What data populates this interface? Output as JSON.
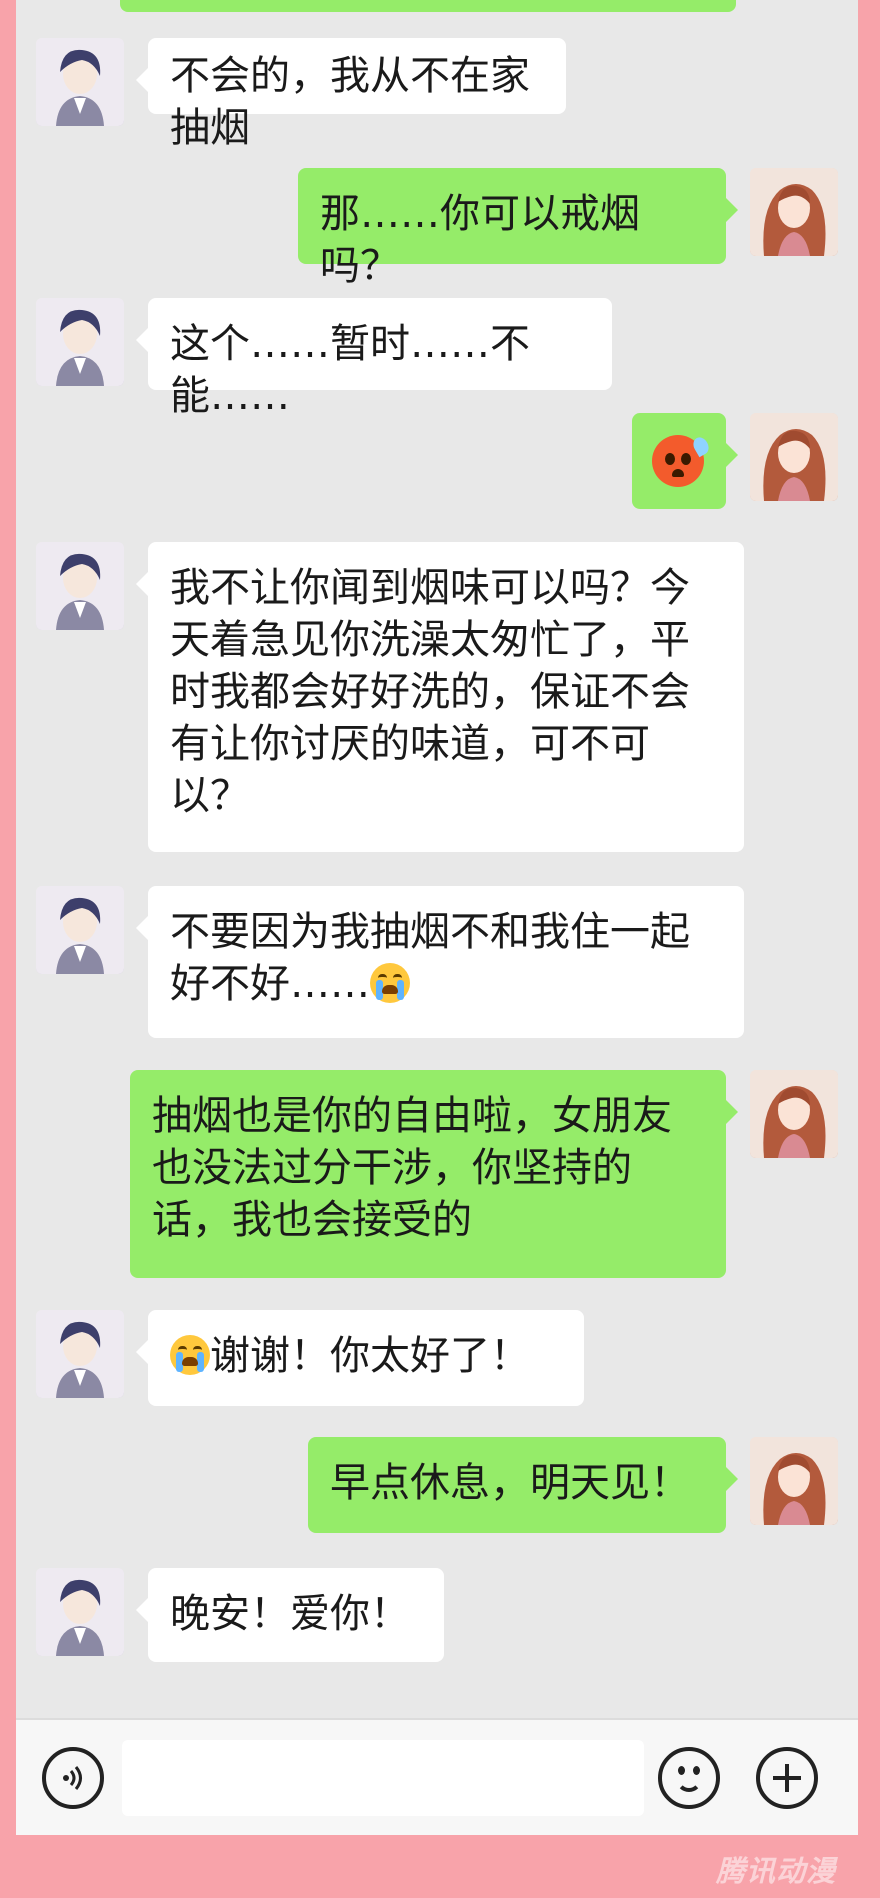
{
  "messages": [
    {
      "side": "left",
      "sender": "boy",
      "text": "不会的，我从不在家抽烟"
    },
    {
      "side": "right",
      "sender": "girl",
      "text": "那……你可以戒烟吗？"
    },
    {
      "side": "left",
      "sender": "boy",
      "text": "这个……暂时……不能……"
    },
    {
      "side": "right",
      "sender": "girl",
      "emoji": "flushed-face"
    },
    {
      "side": "left",
      "sender": "boy",
      "text": "我不让你闻到烟味可以吗？今天着急见你洗澡太匆忙了，平时我都会好好洗的，保证不会有让你讨厌的味道，可不可以？"
    },
    {
      "side": "left",
      "sender": "boy",
      "text": "不要因为我抽烟不和我住一起好不好……",
      "emoji_after": "loudly-crying-face"
    },
    {
      "side": "right",
      "sender": "girl",
      "text": "抽烟也是你的自由啦，女朋友也没法过分干涉，你坚持的话，我也会接受的"
    },
    {
      "side": "left",
      "sender": "boy",
      "emoji_before": "loudly-crying-face",
      "text": "谢谢！你太好了！"
    },
    {
      "side": "right",
      "sender": "girl",
      "text": "早点休息，明天见！"
    },
    {
      "side": "left",
      "sender": "boy",
      "text": "晚安！爱你！"
    }
  ],
  "input_bar": {
    "voice_icon": "voice-icon",
    "emoji_icon": "smile-icon",
    "plus_icon": "plus-icon"
  },
  "watermark": "腾讯动漫",
  "colors": {
    "background": "#f8a3aa",
    "chat_bg": "#e8e8e8",
    "sent_bubble": "#95ec69",
    "received_bubble": "#ffffff"
  }
}
